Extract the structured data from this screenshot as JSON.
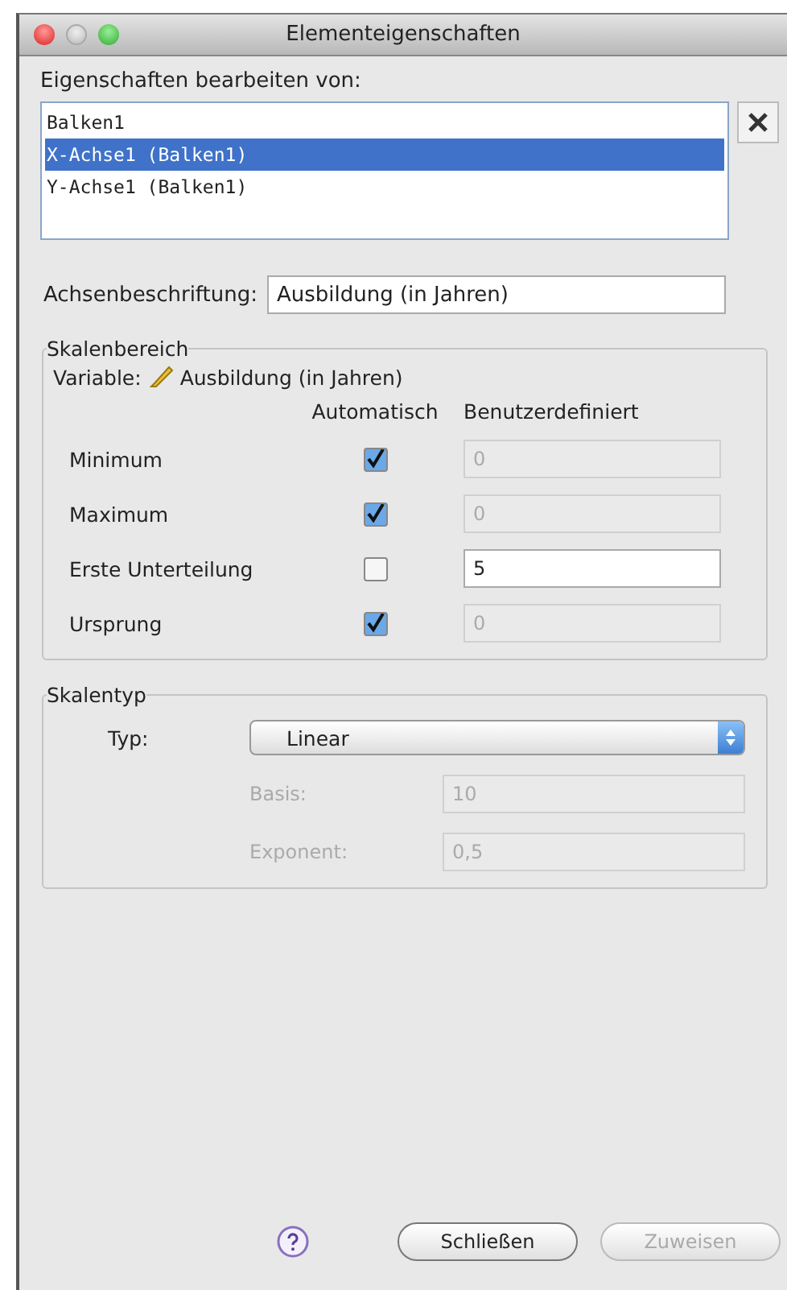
{
  "window": {
    "title": "Elementeigenschaften"
  },
  "edit_label": "Eigenschaften bearbeiten von:",
  "elements": [
    {
      "label": "Balken1",
      "selected": false
    },
    {
      "label": "X-Achse1 (Balken1)",
      "selected": true
    },
    {
      "label": "Y-Achse1 (Balken1)",
      "selected": false
    }
  ],
  "axis_label": {
    "label": "Achsenbeschriftung:",
    "value": "Ausbildung (in Jahren)"
  },
  "scale_range": {
    "title": "Skalenbereich",
    "variable_label": "Variable:",
    "variable": "Ausbildung (in Jahren)",
    "col_auto": "Automatisch",
    "col_custom": "Benutzerdefiniert",
    "rows": [
      {
        "label": "Minimum",
        "checked": true,
        "value": "0"
      },
      {
        "label": "Maximum",
        "checked": true,
        "value": "0"
      },
      {
        "label": "Erste Unterteilung",
        "checked": false,
        "value": "5"
      },
      {
        "label": "Ursprung",
        "checked": true,
        "value": "0"
      }
    ]
  },
  "scale_type": {
    "title": "Skalentyp",
    "type_label": "Typ:",
    "type_value": "Linear",
    "fields": [
      {
        "label": "Basis:",
        "value": "10",
        "disabled": true
      },
      {
        "label": "Exponent:",
        "value": "0,5",
        "disabled": true
      }
    ]
  },
  "buttons": [
    {
      "label": "Schließen",
      "disabled": false
    },
    {
      "label": "Zuweisen",
      "disabled": true
    }
  ]
}
